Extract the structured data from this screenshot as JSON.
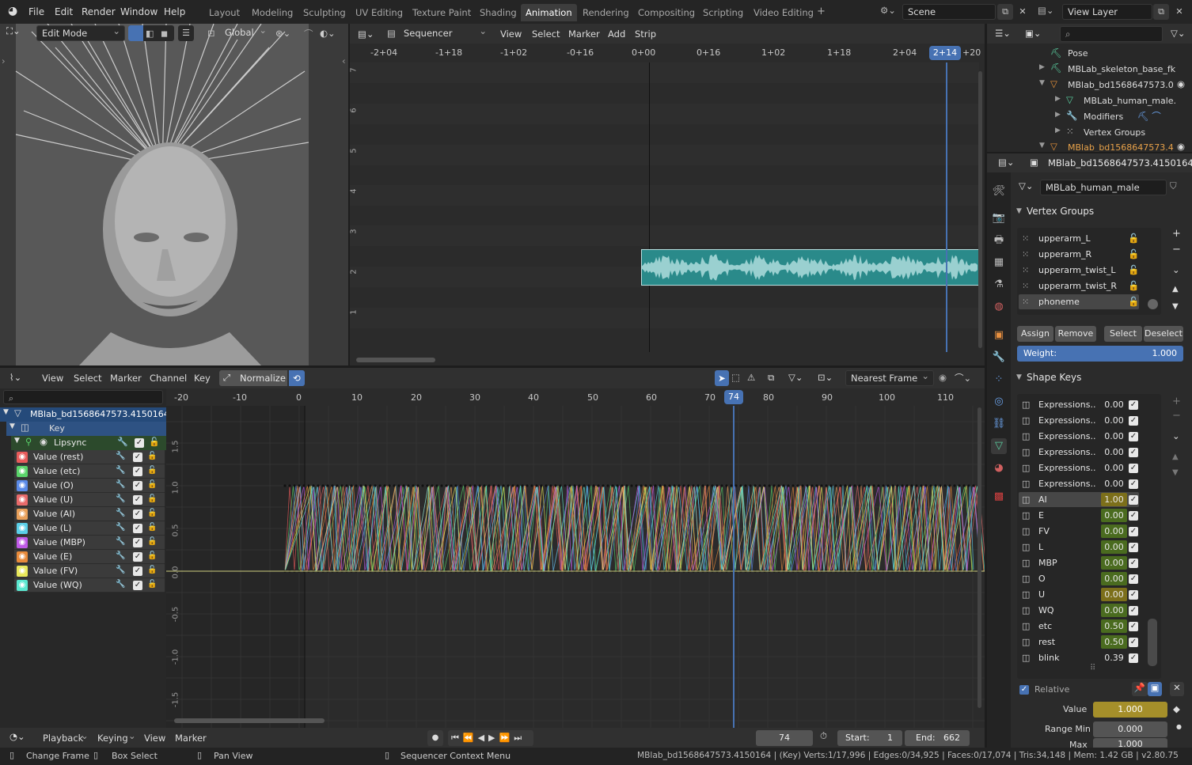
{
  "menus": [
    "File",
    "Edit",
    "Render",
    "Window",
    "Help"
  ],
  "workspaces": [
    "Layout",
    "Modeling",
    "Sculpting",
    "UV Editing",
    "Texture Paint",
    "Shading",
    "Animation",
    "Rendering",
    "Compositing",
    "Scripting",
    "Video Editing"
  ],
  "active_workspace": "Animation",
  "scene": {
    "label": "Scene",
    "view_layer": "View Layer"
  },
  "viewport": {
    "mode": "Edit Mode",
    "orientation": "Global"
  },
  "sequencer": {
    "type": "Sequencer",
    "menu": [
      "View",
      "Select",
      "Marker",
      "Add",
      "Strip"
    ],
    "ticks": [
      "-2+04",
      "-1+18",
      "-1+02",
      "-0+16",
      "0+00",
      "0+16",
      "1+02",
      "1+18",
      "2+04",
      "2+14",
      "+20"
    ],
    "current": "2+14",
    "channels": [
      "7",
      "6",
      "5",
      "4",
      "3",
      "2",
      "1"
    ]
  },
  "graph": {
    "menu": [
      "View",
      "Select",
      "Marker",
      "Channel",
      "Key"
    ],
    "normalize": "Normalize",
    "snap": "Nearest Frame",
    "ticks": [
      "-20",
      "-10",
      "0",
      "10",
      "20",
      "30",
      "40",
      "50",
      "60",
      "70",
      "74",
      "80",
      "90",
      "100",
      "110"
    ],
    "current_frame": "74",
    "yticks": [
      "1.5",
      "1.0",
      "0.5",
      "0.0",
      "-0.5",
      "-1.0",
      "-1.5"
    ],
    "object": "MBlab_bd1568647573.4150164",
    "key": "Key",
    "group": "Lipsync",
    "channels": [
      {
        "label": "Value (rest)",
        "color": "#e85a5a"
      },
      {
        "label": "Value (etc)",
        "color": "#5ad46a"
      },
      {
        "label": "Value (O)",
        "color": "#5a8ae8"
      },
      {
        "label": "Value (U)",
        "color": "#e86a6a"
      },
      {
        "label": "Value (AI)",
        "color": "#e8a05a"
      },
      {
        "label": "Value (L)",
        "color": "#5acfe8"
      },
      {
        "label": "Value (MBP)",
        "color": "#c05ae8"
      },
      {
        "label": "Value (E)",
        "color": "#e88a3a"
      },
      {
        "label": "Value (FV)",
        "color": "#e8e85a"
      },
      {
        "label": "Value (WQ)",
        "color": "#5ae8d0"
      }
    ]
  },
  "timeline": {
    "menu": [
      "Playback",
      "Keying",
      "View",
      "Marker"
    ],
    "frame": "74",
    "start_label": "Start:",
    "start": "1",
    "end_label": "End:",
    "end": "662"
  },
  "outliner": {
    "items": [
      "Pose",
      "MBLab_skeleton_base_fk",
      "MBlab_bd1568647573.0",
      "MBLab_human_male.",
      "Modifiers",
      "Vertex Groups",
      "MBlab_bd1568647573.4"
    ]
  },
  "properties": {
    "object": "MBlab_bd1568647573.4150164",
    "mesh": "MBLab_human_male",
    "vertex_groups_title": "Vertex Groups",
    "vertex_groups": [
      "upperarm_L",
      "upperarm_R",
      "upperarm_twist_L",
      "upperarm_twist_R",
      "phoneme"
    ],
    "vg_buttons": [
      "Assign",
      "Remove",
      "Select",
      "Deselect"
    ],
    "weight_label": "Weight:",
    "weight": "1.000",
    "shape_keys_title": "Shape Keys",
    "shape_keys": [
      {
        "name": "Expressions..",
        "value": "0.00",
        "style": ""
      },
      {
        "name": "Expressions..",
        "value": "0.00",
        "style": ""
      },
      {
        "name": "Expressions..",
        "value": "0.00",
        "style": ""
      },
      {
        "name": "Expressions..",
        "value": "0.00",
        "style": ""
      },
      {
        "name": "Expressions..",
        "value": "0.00",
        "style": ""
      },
      {
        "name": "Expressions..",
        "value": "0.00",
        "style": ""
      },
      {
        "name": "AI",
        "value": "1.00",
        "style": "y"
      },
      {
        "name": "E",
        "value": "0.00",
        "style": "g"
      },
      {
        "name": "FV",
        "value": "0.00",
        "style": "g"
      },
      {
        "name": "L",
        "value": "0.00",
        "style": "g"
      },
      {
        "name": "MBP",
        "value": "0.00",
        "style": "g"
      },
      {
        "name": "O",
        "value": "0.00",
        "style": "g"
      },
      {
        "name": "U",
        "value": "0.00",
        "style": "y"
      },
      {
        "name": "WQ",
        "value": "0.00",
        "style": "g"
      },
      {
        "name": "etc",
        "value": "0.50",
        "style": "g"
      },
      {
        "name": "rest",
        "value": "0.50",
        "style": "g"
      },
      {
        "name": "blink",
        "value": "0.39",
        "style": ""
      }
    ],
    "relative_label": "Relative",
    "value_label": "Value",
    "value": "1.000",
    "range_min_label": "Range Min",
    "range_min": "0.000",
    "max_label": "Max",
    "max": "1.000"
  },
  "status": {
    "change_frame": "Change Frame",
    "box_select": "Box Select",
    "pan_view": "Pan View",
    "context_menu": "Sequencer Context Menu",
    "stats": "MBlab_bd1568647573.4150164 | (Key) Verts:1/17,996 | Edges:0/34,925 | Faces:0/17,074 | Tris:34,148 | Mem: 1.42 GB | v2.80.75"
  },
  "colors": {
    "accent": "#4772b3",
    "strip": "#2a8a8a",
    "wave": "#9ad0d0"
  }
}
